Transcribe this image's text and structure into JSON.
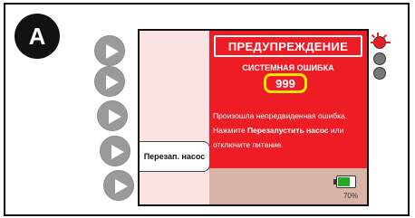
{
  "figure": {
    "label": "A"
  },
  "device_screen": {
    "title": "ПРЕДУПРЕЖДЕНИЕ",
    "error_type": "СИСТЕМНАЯ ОШИБКА",
    "error_code": "999",
    "message_part1": "Произошла непредвиденная ошибка. Нажмите ",
    "message_bold1": "Перезапустить насос",
    "message_part2": " или отключите питание.",
    "restart_button": "Перезап. насос",
    "battery_percent": "70%",
    "battery_level": 0.7
  },
  "side_buttons": [
    {
      "icon": "play-icon"
    },
    {
      "icon": "play-icon"
    },
    {
      "icon": "play-icon"
    },
    {
      "icon": "play-icon"
    },
    {
      "icon": "play-icon"
    }
  ],
  "indicator_lights": [
    {
      "color": "#ee1c24",
      "state": "on"
    },
    {
      "color": "#777777",
      "state": "off"
    },
    {
      "color": "#777777",
      "state": "off"
    }
  ],
  "colors": {
    "alert": "#ee1c24",
    "highlight": "#f2e600",
    "battery": "#22aa22"
  }
}
